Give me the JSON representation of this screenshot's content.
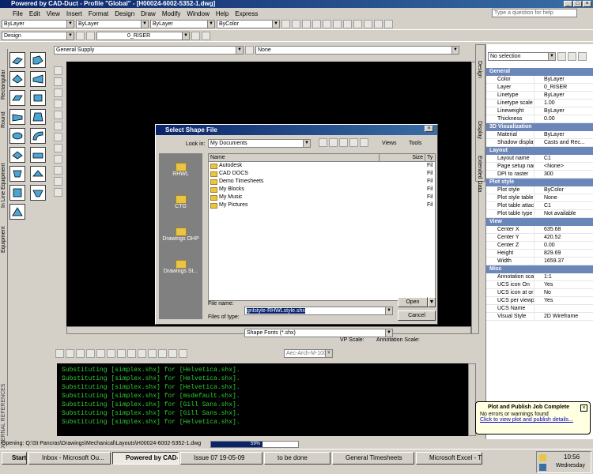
{
  "window": {
    "title": "Powered by CAD-Duct - Profile \"Global\" - [H00024-6002-5352-1.dwg]"
  },
  "menu": [
    "File",
    "Edit",
    "View",
    "Insert",
    "Format",
    "Design",
    "Draw",
    "Modify",
    "Window",
    "Help",
    "Express"
  ],
  "help_search": {
    "placeholder": "Type a question for help"
  },
  "toolbar": {
    "layer_combo": "ByLayer",
    "linetype_combo": "ByLayer",
    "lineweight_combo": "ByLayer",
    "color_combo": "ByColor",
    "design_combo": "Design",
    "layer_name": "0_RISER",
    "system_combo": "General Supply",
    "none_combo": "None"
  },
  "palette_tabs": [
    "Rectangular",
    "Round",
    "In Line Equipment",
    "Equipment",
    "EXTERNAL REFERENCES"
  ],
  "dialog": {
    "title": "Select Shape File",
    "look_in_label": "Look in:",
    "look_in_value": "My Documents",
    "views_label": "Views",
    "tools_label": "Tools",
    "places": [
      "RHWL",
      "CTG",
      "Drawings OHP",
      "Drawings St..."
    ],
    "columns": {
      "name": "Name",
      "size": "Size",
      "type": "Ty"
    },
    "files": [
      {
        "name": "Autodesk",
        "type": "Fil"
      },
      {
        "name": "CAD DOCS",
        "type": "Fil"
      },
      {
        "name": "Demo Timesheets",
        "type": "Fil"
      },
      {
        "name": "My Blocks",
        "type": "Fil"
      },
      {
        "name": "My Music",
        "type": "Fil"
      },
      {
        "name": "My Pictures",
        "type": "Fil"
      }
    ],
    "filename_label": "File name:",
    "filename_value": "gnlstyle-RHWLstyle.shx",
    "filetype_label": "Files of type:",
    "filetype_value": "Shape Fonts (*.shx)",
    "open_button": "Open",
    "cancel_button": "Cancel"
  },
  "drawing_status": {
    "vp_scale": "VP Scale:",
    "annotation_scale": "Annotation Scale:"
  },
  "dim_style": "Aec-Arch-M-100",
  "command_lines": [
    "Substituting [simplex.shx] for [Helvetica.shx].",
    "Substituting [simplex.shx] for [Helvetica.shx].",
    "Substituting [simplex.shx] for [Helvetica.shx].",
    "Substituting [simplex.shx] for [msdefault.shx].",
    "Substituting [simplex.shx] for [Gill Sans.shx].",
    "Substituting [simplex.shx] for [Gill Sans.shx].",
    "Substituting [simplex.shx] for [Helvetica.shx]."
  ],
  "properties": {
    "selection": "No selection",
    "side_tabs": [
      "Design",
      "Display",
      "Extended Data"
    ],
    "sections": [
      {
        "title": "General",
        "rows": [
          {
            "k": "Color",
            "v": "ByLayer"
          },
          {
            "k": "Layer",
            "v": "0_RISER"
          },
          {
            "k": "Linetype",
            "v": "ByLayer"
          },
          {
            "k": "Linetype scale",
            "v": "1.00"
          },
          {
            "k": "Lineweight",
            "v": "ByLayer"
          },
          {
            "k": "Thickness",
            "v": "0.00"
          }
        ]
      },
      {
        "title": "3D Visualization",
        "rows": [
          {
            "k": "Material",
            "v": "ByLayer"
          },
          {
            "k": "Shadow display",
            "v": "Casts and Rec..."
          }
        ]
      },
      {
        "title": "Layout",
        "rows": [
          {
            "k": "Layout name",
            "v": "C1"
          },
          {
            "k": "Page setup name",
            "v": "<None>"
          },
          {
            "k": "DPI to raster",
            "v": "300"
          }
        ]
      },
      {
        "title": "Plot style",
        "rows": [
          {
            "k": "Plot style",
            "v": "ByColor"
          },
          {
            "k": "Plot style table",
            "v": "None"
          },
          {
            "k": "Plot table attache...",
            "v": "C1"
          },
          {
            "k": "Plot table type",
            "v": "Not available"
          }
        ]
      },
      {
        "title": "View",
        "rows": [
          {
            "k": "Center X",
            "v": "635.68"
          },
          {
            "k": "Center Y",
            "v": "420.52"
          },
          {
            "k": "Center Z",
            "v": "0.00"
          },
          {
            "k": "Height",
            "v": "829.69"
          },
          {
            "k": "Width",
            "v": "1659.37"
          }
        ]
      },
      {
        "title": "Misc",
        "rows": [
          {
            "k": "Annotation scale",
            "v": "1:1"
          },
          {
            "k": "UCS icon On",
            "v": "Yes"
          },
          {
            "k": "UCS icon at origin",
            "v": "No"
          },
          {
            "k": "UCS per viewport",
            "v": "Yes"
          },
          {
            "k": "UCS Name",
            "v": ""
          },
          {
            "k": "Visual Style",
            "v": "2D Wireframe"
          }
        ]
      }
    ]
  },
  "status": {
    "opening": "Opening: Q:\\St Pancras\\Drawings\\Mechanical\\Layouts\\H00024-6002-5352-1.dwg",
    "progress_label": "59%",
    "progress": 0.59
  },
  "balloon": {
    "title": "Plot and Publish Job Complete",
    "line1": "No errors or warnings found",
    "link": "Click to view plot and publish details..."
  },
  "taskbar": {
    "start": "Start",
    "tasks": [
      "Inbox - Microsoft Ou...",
      "Powered by CAD-...",
      "Issue 07 19-05-09",
      "to be done",
      "General Timesheets",
      "Microsoft Excel - Tim..."
    ],
    "clock": "10:56",
    "day": "Wednesday"
  },
  "colors": {
    "cmd_text": "#2fce35",
    "title_blue": "#0a246a",
    "section_blue": "#6b86b8"
  }
}
